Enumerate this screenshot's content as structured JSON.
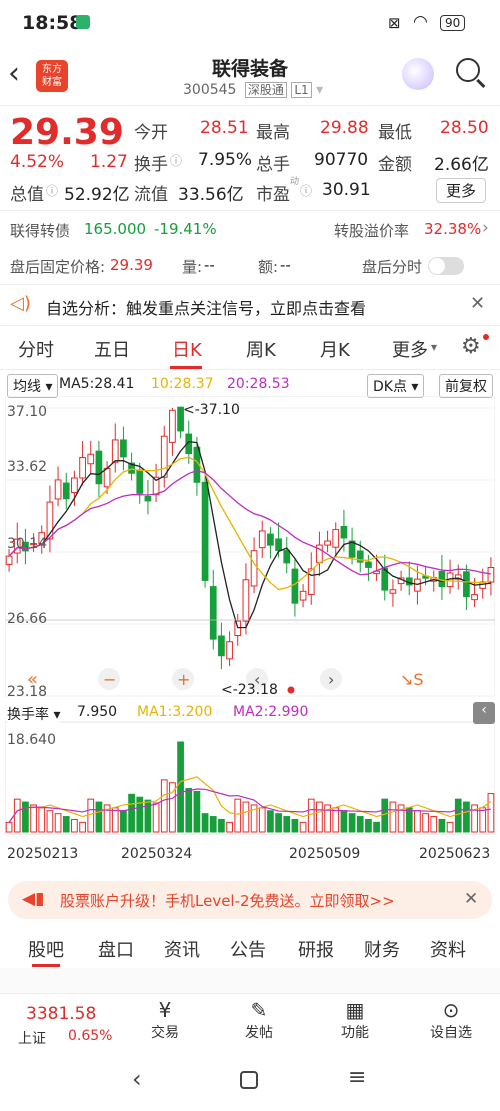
{
  "status": {
    "time": "18:58",
    "battery": "90"
  },
  "header": {
    "logo_line1": "东方",
    "logo_line2": "财富",
    "name": "联得装备",
    "code": "300545",
    "tag1": "深股通",
    "tag2": "L1"
  },
  "quote": {
    "price": "29.39",
    "pct": "4.52%",
    "chg": "1.27",
    "open_l": "今开",
    "open": "28.51",
    "high_l": "最高",
    "high": "29.88",
    "low_l": "最低",
    "low": "28.50",
    "turn_l": "换手",
    "turn": "7.95%",
    "vol_l": "总手",
    "vol": "90770",
    "amt_l": "金额",
    "amt": "2.66亿",
    "mcap_l": "总值",
    "mcap": "52.92亿",
    "float_l": "流值",
    "float": "33.56亿",
    "pe_l": "市盈",
    "pe_sup": "动",
    "pe": "30.91",
    "more": "更多",
    "cb_l": "联得转债",
    "cb": "165.000",
    "cb_pct": "-19.41%",
    "prem_l": "转股溢价率",
    "prem": "32.38%",
    "ah_l": "盘后固定价格:",
    "ah": "29.39",
    "ahv_l": "量:",
    "ahv": "--",
    "aha_l": "额:",
    "aha": "--",
    "ahm": "盘后分时"
  },
  "notice": {
    "text": "自选分析：触发重点关注信号，立即点击查看"
  },
  "tabs": [
    "分时",
    "五日",
    "日K",
    "周K",
    "月K",
    "更多"
  ],
  "chart": {
    "ma_btn": "均线",
    "ma5": "MA5:28.41",
    "ma10": "10:28.37",
    "ma20": "20:28.53",
    "dk": "DK点",
    "adj": "前复权",
    "y_labels": [
      "37.10",
      "33.62",
      "30.14",
      "26.66",
      "23.18"
    ],
    "hi_note": "<-37.10",
    "lo_note": "<-23.18",
    "vol_btn": "换手率",
    "vol_val": "7.950",
    "ma1": "MA1:3.200",
    "ma2": "MA2:2.990",
    "vol_max": "18.640",
    "dates": [
      "20250213",
      "20250324",
      "20250509",
      "20250623"
    ]
  },
  "chart_data": {
    "type": "candlestick",
    "ylim": [
      23.18,
      37.1
    ],
    "high": 37.1,
    "low": 23.18,
    "last_close": 29.39,
    "ma": {
      "MA5": 28.41,
      "MA10": 28.37,
      "MA20": 28.53
    },
    "turnover": {
      "last": 7.95,
      "MA1": 3.2,
      "MA2": 2.99,
      "max": 18.64
    },
    "dates": [
      "20250213",
      "20250324",
      "20250509",
      "20250623"
    ]
  },
  "banner": {
    "text": "股票账户升级！手机Level-2免费送。立即领取>>"
  },
  "btabs": [
    "股吧",
    "盘口",
    "资讯",
    "公告",
    "研报",
    "财务",
    "资料"
  ],
  "bottom": {
    "index": "3381.58",
    "index_l": "上证",
    "index_pct": "0.65%",
    "nav": [
      "交易",
      "发帖",
      "功能",
      "设自选"
    ]
  },
  "colors": {
    "up": "#e22b2b",
    "down": "#179f3b",
    "ma5": "#222222",
    "ma10": "#e8b400",
    "ma20": "#c02cc0"
  }
}
